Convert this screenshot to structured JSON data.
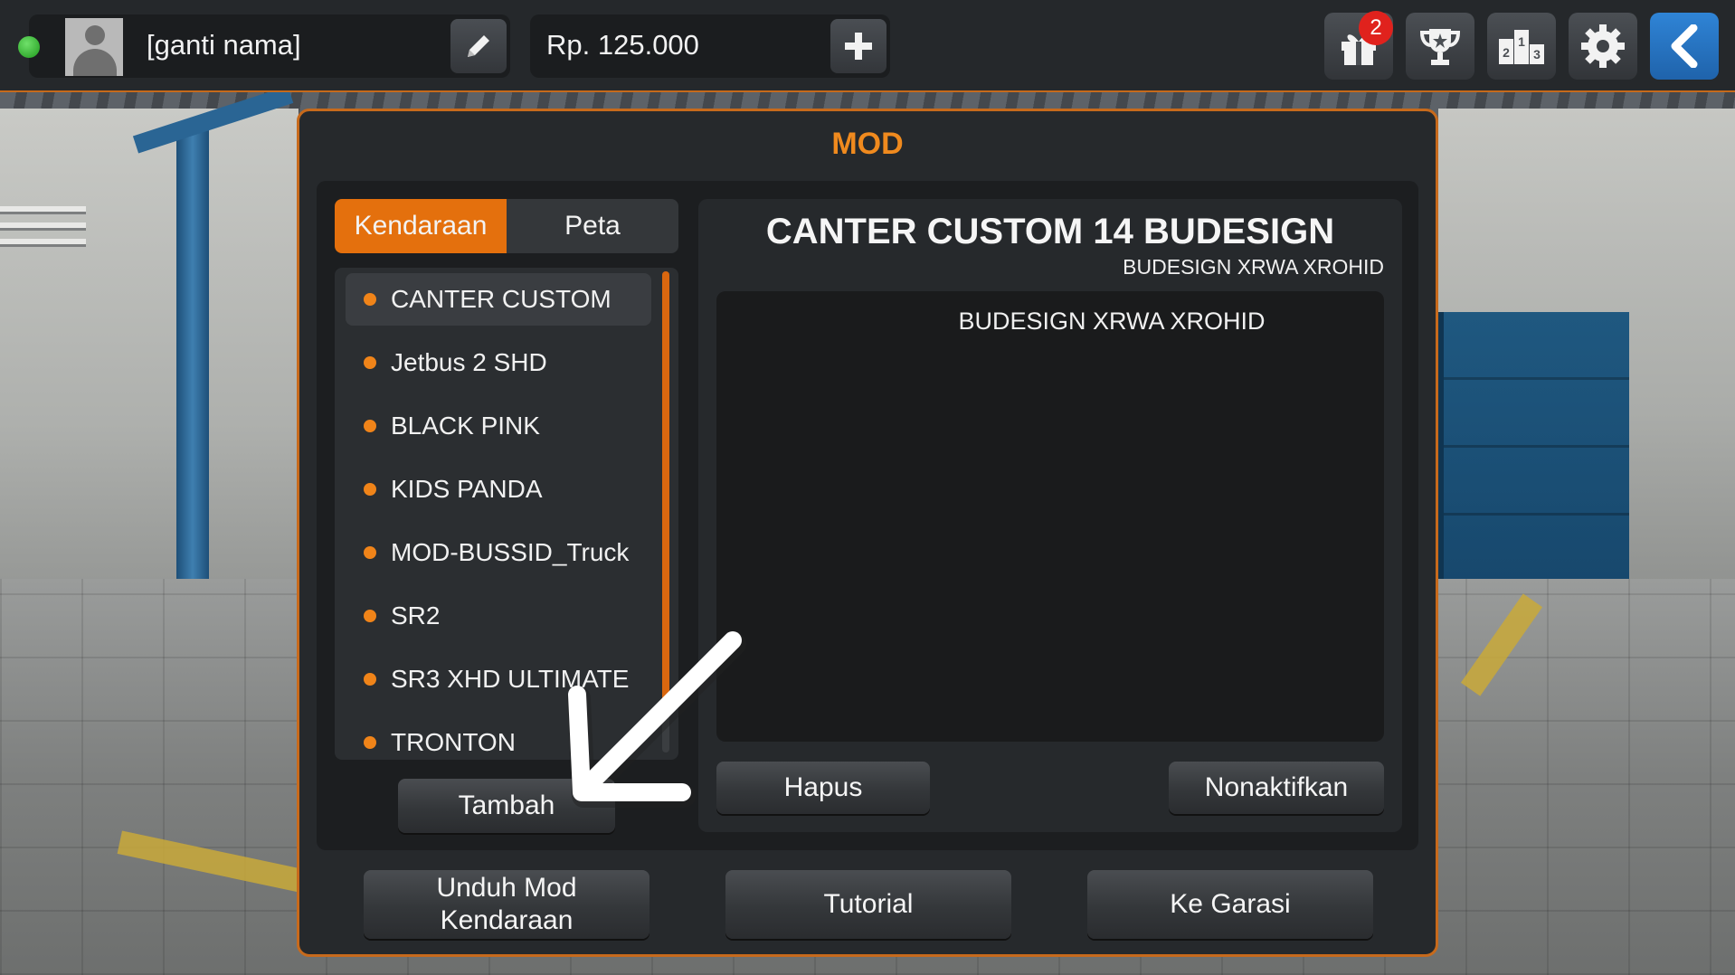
{
  "topbar": {
    "player_name": "[ganti nama]",
    "money": "Rp. 125.000",
    "gift_badge_count": "2",
    "icons": {
      "status": "online-status-icon",
      "avatar": "avatar-icon",
      "edit": "pencil-icon",
      "add_money": "plus-icon",
      "gift": "gift-icon",
      "trophy": "trophy-icon",
      "leaderboard": "podium-icon",
      "settings": "gear-icon",
      "back": "chevron-left-icon"
    }
  },
  "modal": {
    "title": "MOD",
    "tabs": [
      {
        "label": "Kendaraan",
        "active": true
      },
      {
        "label": "Peta",
        "active": false
      }
    ],
    "mod_list": [
      {
        "label": "CANTER CUSTOM",
        "selected": true
      },
      {
        "label": "Jetbus 2 SHD",
        "selected": false
      },
      {
        "label": "BLACK PINK",
        "selected": false
      },
      {
        "label": "KIDS PANDA",
        "selected": false
      },
      {
        "label": "MOD-BUSSID_Truck",
        "selected": false
      },
      {
        "label": "SR2",
        "selected": false
      },
      {
        "label": "SR3 XHD ULTIMATE",
        "selected": false
      },
      {
        "label": "TRONTON",
        "selected": false
      }
    ],
    "add_button": "Tambah",
    "detail": {
      "title": "CANTER CUSTOM 14 BUDESIGN",
      "author": "BUDESIGN XRWA XROHID",
      "description": "BUDESIGN XRWA XROHID",
      "delete_button": "Hapus",
      "disable_button": "Nonaktifkan"
    },
    "bottom_buttons": {
      "download_line1": "Unduh Mod",
      "download_line2": "Kendaraan",
      "tutorial": "Tutorial",
      "garage": "Ke Garasi"
    }
  },
  "colors": {
    "accent": "#e4700d",
    "title": "#f08a1e",
    "back_button": "#2f84d6",
    "badge": "#e0221d",
    "status": "#3cc238"
  }
}
